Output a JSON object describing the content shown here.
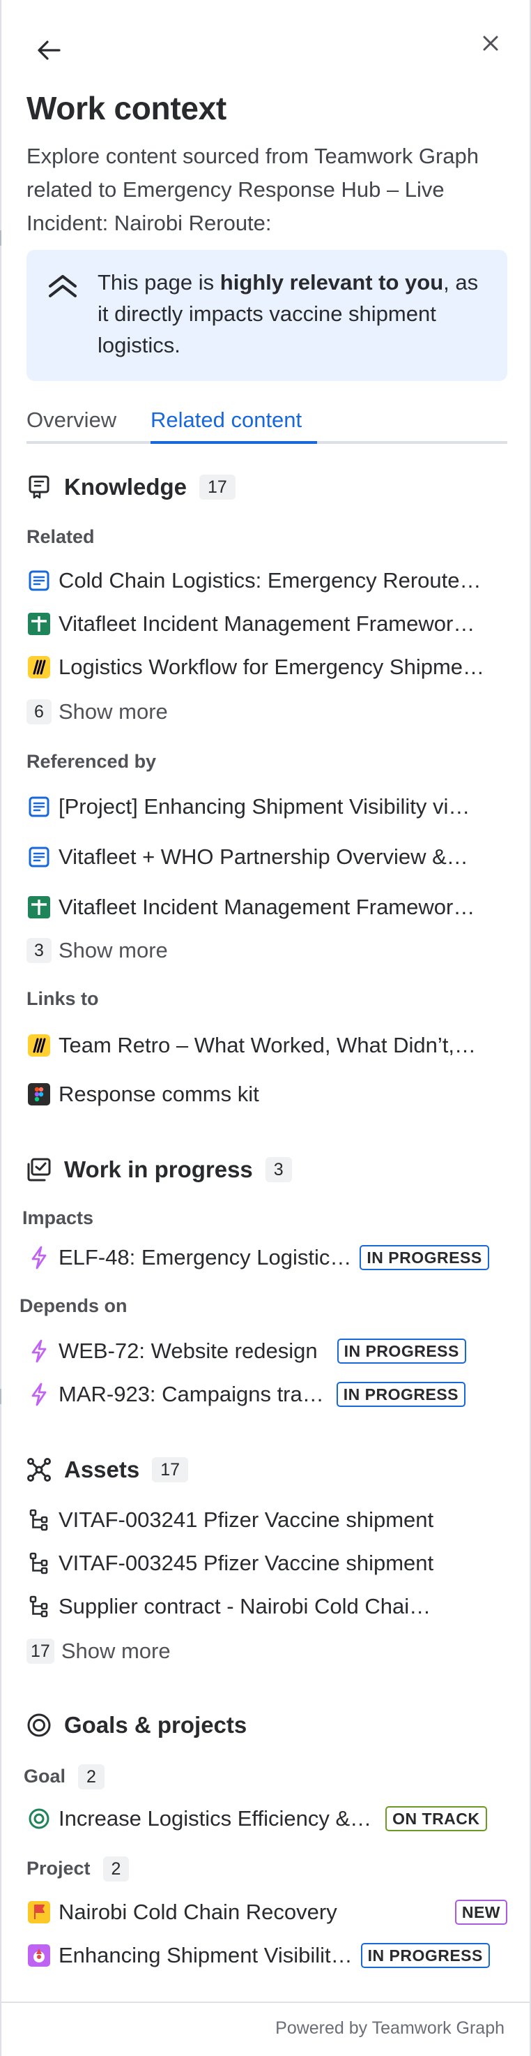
{
  "header": {
    "title": "Work context",
    "subtitle": "Explore content sourced from Teamwork Graph related to Emergency Response Hub – Live Incident: Nairobi Reroute:"
  },
  "relevance": {
    "prefix": "This page is ",
    "bold": "highly relevant to you",
    "suffix": ", as it directly impacts vaccine shipment logistics."
  },
  "tabs": [
    {
      "label": "Overview",
      "active": false
    },
    {
      "label": "Related content",
      "active": true
    }
  ],
  "knowledge": {
    "title": "Knowledge",
    "count": "17",
    "related": {
      "label": "Related",
      "items": [
        {
          "icon": "page-icon",
          "label": "Cold Chain Logistics: Emergency Reroute…"
        },
        {
          "icon": "sheet-icon",
          "label": "Vitafleet Incident Management Framewor…"
        },
        {
          "icon": "miro-icon",
          "label": "Logistics Workflow for Emergency Shipme…"
        }
      ],
      "more_count": "6",
      "more_label": "Show more"
    },
    "referenced_by": {
      "label": "Referenced by",
      "items": [
        {
          "icon": "page-icon",
          "label": "[Project] Enhancing Shipment Visibility vi…"
        },
        {
          "icon": "page-icon",
          "label": "Vitafleet + WHO Partnership Overview &…"
        },
        {
          "icon": "sheet-icon",
          "label": "Vitafleet Incident Management Framewor…"
        }
      ],
      "more_count": "3",
      "more_label": "Show more"
    },
    "links_to": {
      "label": "Links to",
      "items": [
        {
          "icon": "miro-icon",
          "label": "Team Retro – What Worked, What Didn’t,…"
        },
        {
          "icon": "figma-icon",
          "label": "Response comms kit"
        }
      ]
    }
  },
  "work_in_progress": {
    "title": "Work in progress",
    "count": "3",
    "impacts": {
      "label": "Impacts",
      "items": [
        {
          "icon": "lightning-icon",
          "label": "ELF-48: Emergency Logistic…",
          "status": "IN PROGRESS"
        }
      ]
    },
    "depends_on": {
      "label": "Depends on",
      "items": [
        {
          "icon": "lightning-icon",
          "label": "WEB-72: Website redesign",
          "status": "IN PROGRESS"
        },
        {
          "icon": "lightning-icon",
          "label": "MAR-923: Campaigns tra…",
          "status": "IN PROGRESS"
        }
      ]
    }
  },
  "assets": {
    "title": "Assets",
    "count": "17",
    "items": [
      {
        "icon": "asset-icon",
        "label": "VITAF-003241 Pfizer Vaccine shipment"
      },
      {
        "icon": "asset-icon",
        "label": "VITAF-003245 Pfizer Vaccine shipment"
      },
      {
        "icon": "asset-icon",
        "label": "Supplier contract - Nairobi Cold Chai…"
      }
    ],
    "more_count": "17",
    "more_label": "Show more"
  },
  "goals_projects": {
    "title": "Goals & projects",
    "goal": {
      "label": "Goal",
      "count": "2",
      "items": [
        {
          "icon": "goal-icon",
          "label": "Increase Logistics Efficiency &…",
          "status": "ON TRACK"
        }
      ]
    },
    "project": {
      "label": "Project",
      "count": "2",
      "items": [
        {
          "icon": "flag-project-icon",
          "label": "Nairobi Cold Chain Recovery",
          "status": "NEW"
        },
        {
          "icon": "rocket-project-icon",
          "label": "Enhancing Shipment Visibilit…",
          "status": "IN PROGRESS"
        }
      ]
    }
  },
  "footer": {
    "text": "Powered by Teamwork Graph"
  },
  "colors": {
    "link_blue": "#1868db",
    "relevance_bg": "#e9f2fe",
    "in_progress_border": "#1868db",
    "on_track_border": "#6a9a23",
    "new_border": "#af59e1",
    "lightning": "#bf63f3"
  }
}
